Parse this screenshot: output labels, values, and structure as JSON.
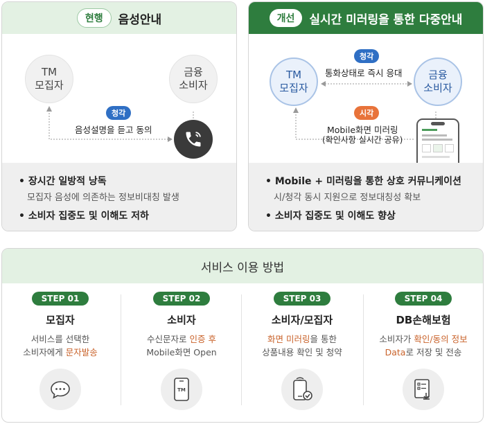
{
  "current": {
    "tag": "현행",
    "title": "음성안내",
    "node_tm": "TM\n모집자",
    "node_consumer": "금융\n소비자",
    "badge": "청각",
    "caption": "음성설명을 듣고 동의",
    "bullets": [
      {
        "title": "장시간 일방적 낭독",
        "sub": "모집자 음성에 의존하는 정보비대칭 발생"
      },
      {
        "title": "소비자 집중도 및 이해도 저하",
        "sub": ""
      }
    ]
  },
  "improved": {
    "tag": "개선",
    "title": "실시간 미러링을 통한 다중안내",
    "node_tm": "TM\n모집자",
    "node_consumer": "금융\n소비자",
    "badge_top": "청각",
    "caption_top": "통화상태로 즉시 응대",
    "badge_bottom": "시각",
    "caption_bottom_1": "Mobile화면 미러링",
    "caption_bottom_2": "(확인사항 실시간 공유)",
    "bullets": [
      {
        "title": "Mobile + 미러링을 통한 상호 커뮤니케이션",
        "sub": "시/청각 동시 지원으로 정보대칭성 확보"
      },
      {
        "title": "소비자 집중도 및 이해도 향상",
        "sub": ""
      }
    ]
  },
  "service": {
    "title": "서비스 이용 방법",
    "steps": [
      {
        "pill": "STEP 01",
        "title": "모집자",
        "desc_1": "서비스를 선택한",
        "desc_2a": "소비자에게 ",
        "desc_2b": "문자발송",
        "icon": "chat-icon"
      },
      {
        "pill": "STEP 02",
        "title": "소비자",
        "desc_1a": "수신문자로 ",
        "desc_1b": "인증 후",
        "desc_2": "Mobile화면 Open",
        "icon": "phone-tm-icon"
      },
      {
        "pill": "STEP 03",
        "title": "소비자/모집자",
        "desc_1a": "화면 미러링",
        "desc_1b": "을 통한",
        "desc_2": "상품내용 확인 및 청약",
        "icon": "phone-check-icon"
      },
      {
        "pill": "STEP 04",
        "title": "DB손해보험",
        "desc_1a": "소비자가 ",
        "desc_1b": "확인/동의 정보",
        "desc_2a": "Data",
        "desc_2b": "로 저장 및 전송",
        "icon": "document-icon"
      }
    ]
  },
  "colors": {
    "green_dark": "#2e7d3e",
    "green_light": "#e3f1e3",
    "blue_badge": "#2f6fc4",
    "orange_badge": "#e8733a",
    "highlight": "#c9622a"
  }
}
